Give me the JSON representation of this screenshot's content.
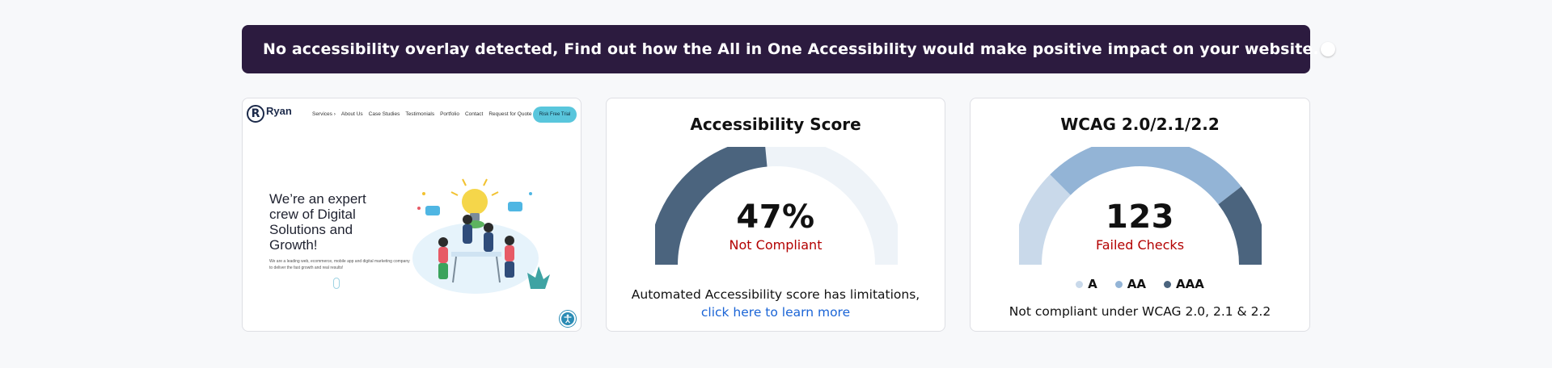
{
  "banner": {
    "text": "No accessibility overlay detected, Find out how the All in One Accessibility would make positive impact on your website.",
    "toggle_on": false
  },
  "preview": {
    "logo_letter": "R",
    "logo_name": "Ryan",
    "nav": [
      "Services ›",
      "About Us",
      "Case Studies",
      "Testimonials",
      "Portfolio",
      "Contact",
      "Request for Quote"
    ],
    "cta": "Risk Free Trial",
    "heading": "We’re an expert crew of Digital Solutions and Growth!",
    "subtext": "We are a leading web, ecommerce, mobile app and digital marketing company to deliver the fast growth and real results!"
  },
  "score": {
    "title": "Accessibility Score",
    "value": "47%",
    "percent": 47,
    "status": "Not Compliant",
    "note": "Automated Accessibility score has limitations,",
    "link": "click here to learn more",
    "colors": {
      "filled": "#4b647e",
      "track": "#eef3f8",
      "status": "#b30000",
      "link": "#1a64d6"
    }
  },
  "wcag": {
    "title": "WCAG 2.0/2.1/2.2",
    "value": "123",
    "status": "Failed Checks",
    "legend": [
      {
        "label": "A",
        "color": "#c9d9ea"
      },
      {
        "label": "AA",
        "color": "#93b4d6"
      },
      {
        "label": "AAA",
        "color": "#4b647e"
      }
    ],
    "segments": [
      {
        "level": "A",
        "fraction": 0.25
      },
      {
        "level": "AA",
        "fraction": 0.54
      },
      {
        "level": "AAA",
        "fraction": 0.21
      }
    ],
    "note": "Not compliant under WCAG 2.0, 2.1 & 2.2"
  },
  "icons": {
    "toggle": "toggle-switch",
    "logo": "ryan-logo-icon",
    "illustration": "team-lightbulb-illustration",
    "accessibility_widget": "accessibility-icon"
  }
}
